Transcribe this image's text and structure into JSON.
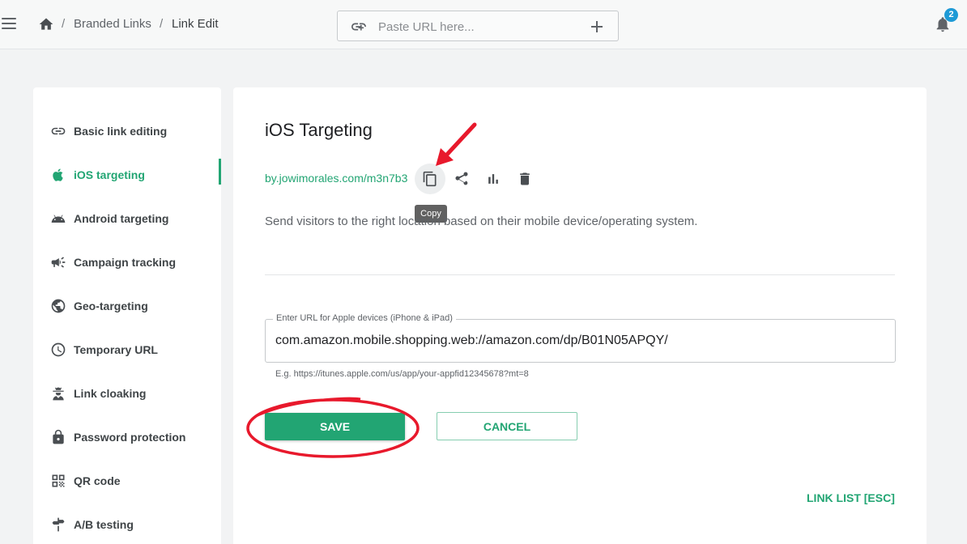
{
  "header": {
    "breadcrumb": [
      "Branded Links",
      "Link Edit"
    ],
    "breadcrumb_separator": "/",
    "url_input": {
      "placeholder": "Paste URL here...",
      "value": ""
    },
    "notifications_count": "2"
  },
  "sidebar": {
    "active_index": 1,
    "items": [
      {
        "label": "Basic link editing",
        "icon": "link-icon"
      },
      {
        "label": "iOS targeting",
        "icon": "apple-icon"
      },
      {
        "label": "Android targeting",
        "icon": "android-icon"
      },
      {
        "label": "Campaign tracking",
        "icon": "megaphone-icon"
      },
      {
        "label": "Geo-targeting",
        "icon": "globe-icon"
      },
      {
        "label": "Temporary URL",
        "icon": "clock-icon"
      },
      {
        "label": "Link cloaking",
        "icon": "spy-icon"
      },
      {
        "label": "Password protection",
        "icon": "lock-icon"
      },
      {
        "label": "QR code",
        "icon": "qr-code-icon"
      },
      {
        "label": "A/B testing",
        "icon": "signpost-icon"
      }
    ]
  },
  "main": {
    "title": "iOS Targeting",
    "short_link": "by.jowimorales.com/m3n7b3",
    "tooltip": "Copy",
    "description": "Send visitors to the right location based on their mobile device/operating system.",
    "apple_url_field": {
      "label": "Enter URL for Apple devices (iPhone & iPad)",
      "value": "com.amazon.mobile.shopping.web://amazon.com/dp/B01N05APQY/",
      "hint": "E.g. https://itunes.apple.com/us/app/your-appfid12345678?mt=8"
    },
    "save_label": "SAVE",
    "cancel_label": "CANCEL",
    "link_list_label": "LINK LIST [ESC]"
  },
  "colors": {
    "accent": "#22a573",
    "badge": "#1e9ad6",
    "annotation": "#e8192c"
  }
}
